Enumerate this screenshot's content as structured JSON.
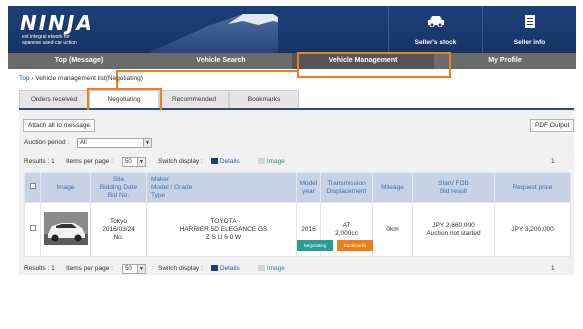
{
  "header": {
    "logo_title": "NINJA",
    "logo_subtitle_line1": "ext integral etwork for",
    "logo_subtitle_line2": "apanese used-car uction",
    "sellers_stock_label": "Seller's stock",
    "seller_info_label": "Seller info"
  },
  "nav": {
    "items": [
      {
        "label": "Top (Message)"
      },
      {
        "label": "Vehicle Search"
      },
      {
        "label": "Vehicle Management"
      },
      {
        "label": "My Profile"
      }
    ]
  },
  "breadcrumb": {
    "top": "Top",
    "separator": " › ",
    "current": "Vehicle management list(Negotiating)"
  },
  "tabs": [
    {
      "label": "Orders received"
    },
    {
      "label": "Negotiating"
    },
    {
      "label": "Recommended"
    },
    {
      "label": "Bookmarks"
    }
  ],
  "toolbar": {
    "attach_all_label": "Attach all to message",
    "pdf_output_label": "PDF Output",
    "auction_period_label": "Auction period :",
    "auction_period_value": "All",
    "results_label": "Results : 1",
    "items_per_page_label": "Items per page :",
    "items_per_page_value": "50",
    "switch_display_label": "Switch display :",
    "details_label": "Details",
    "image_label": "Image",
    "page_number": "1"
  },
  "table": {
    "headers": {
      "image": "Image",
      "site_line1": "Site",
      "site_line2": "Bidding Date",
      "site_line3": "Bid No.",
      "maker_line1": "Maker",
      "maker_line2": "Model / Grade",
      "maker_line3": "Type",
      "model_year_line1": "Model",
      "model_year_line2": "year",
      "transmission_line1": "Transmission",
      "transmission_line2": "Displacement",
      "mileage": "Mileage",
      "start_line1": "Start/ FOB",
      "start_line2": "Bid result",
      "request_price": "Request price"
    },
    "row": {
      "site": "Tokyo",
      "bidding_date": "2016/03/24",
      "bid_no": "No.",
      "maker": "TOYOTA",
      "model_grade": "HARRIER 5D  ELEGANCE GS",
      "type": "Z S U 6 0 W",
      "model_year": "2016",
      "transmission": "AT",
      "displacement": "2,000cc",
      "mileage": "0km",
      "start_price": "JPY 2,660,000",
      "bid_result": "Auction not started",
      "request_price": "JPY 3,200,000",
      "negotiating_btn": "Negotiating",
      "bookmarks_btn": "Bookmarks"
    }
  },
  "colors": {
    "header_bg": "#1d3f78",
    "nav_bg": "#6b6b6b",
    "highlight": "#f07f22",
    "table_header_bg": "#c8d2e6",
    "negotiating_btn": "#2a9d96",
    "bookmarks_btn": "#ef7d1a"
  }
}
